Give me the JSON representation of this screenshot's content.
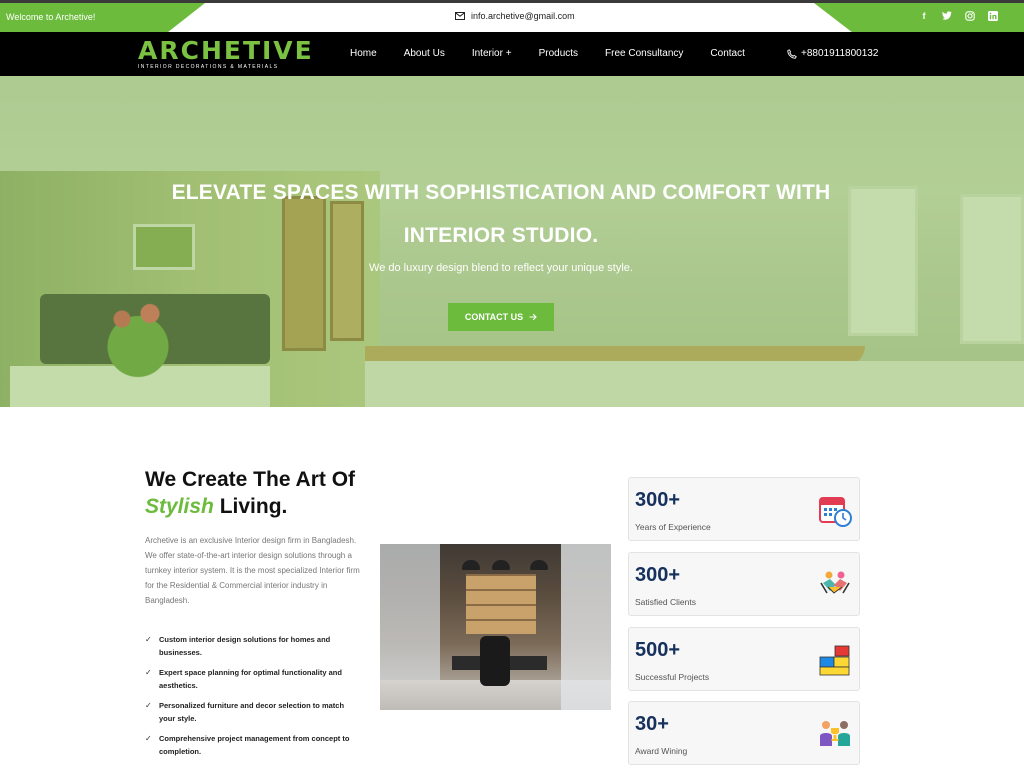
{
  "topbar": {
    "welcome": "Welcome to Archetive!",
    "email": "info.archetive@gmail.com",
    "socials": [
      "facebook-icon",
      "twitter-icon",
      "instagram-icon",
      "linkedin-icon"
    ]
  },
  "nav": {
    "logo_word": "ARCHETIVE",
    "logo_sub": "INTERIOR DECORATIONS & MATERIALS",
    "items": [
      "Home",
      "About Us",
      "Interior +",
      "Products",
      "Free Consultancy",
      "Contact"
    ],
    "phone": "+8801911800132"
  },
  "hero": {
    "title_line1": "ELEVATE SPACES WITH SOPHISTICATION AND COMFORT WITH",
    "title_line2": "INTERIOR STUDIO.",
    "tagline": "We do luxury design blend to reflect your unique style.",
    "cta": "CONTACT US"
  },
  "about": {
    "title_line1": "We Create The Art Of",
    "title_accent": "Stylish",
    "title_rest": " Living.",
    "paragraph": "Archetive is an exclusive Interior design firm in Bangladesh. We offer state-of-the-art interior design solutions through a turnkey interior system. It is the most specialized Interior firm for the Residential & Commercial interior industry in Bangladesh.",
    "checks": [
      "Custom interior design solutions for homes and businesses.",
      "Expert space planning for optimal functionality and aesthetics.",
      "Personalized furniture and decor selection to match your style.",
      "Comprehensive project management from concept to completion."
    ]
  },
  "stats": [
    {
      "num": "300+",
      "label": "Years of Experience",
      "icon": "calendar-clock-icon"
    },
    {
      "num": "300+",
      "label": "Satisfied Clients",
      "icon": "handshake-icon"
    },
    {
      "num": "500+",
      "label": "Successful Projects",
      "icon": "blocks-icon"
    },
    {
      "num": "30+",
      "label": "Award Wining",
      "icon": "award-people-icon"
    }
  ],
  "colors": {
    "accent": "#6cbb3c",
    "navy": "#17315e",
    "nav_bg": "#000000"
  }
}
